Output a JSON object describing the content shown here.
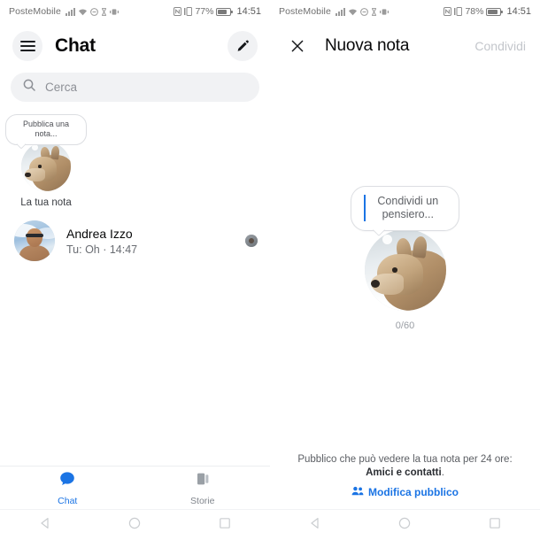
{
  "left": {
    "statusbar": {
      "carrier": "PosteMobile",
      "battery_pct": "77%",
      "clock": "14:51",
      "icons": [
        "signal-bars-icon",
        "wifi-icon",
        "dnd-icon",
        "hourglass-icon",
        "alarm-icon",
        "nfc-icon",
        "vibrate-icon",
        "battery-icon"
      ]
    },
    "appbar": {
      "menu_icon": "hamburger-menu-icon",
      "title": "Chat",
      "compose_icon": "pencil-edit-icon"
    },
    "search": {
      "icon": "search-icon",
      "placeholder": "Cerca"
    },
    "notes": {
      "bubble_text": "Pubblica una nota...",
      "label": "La tua nota",
      "avatar": "dog-avatar"
    },
    "chats": [
      {
        "name": "Andrea Izzo",
        "snippet": "Tu: Oh · 14:47",
        "avatar": "man-avatar",
        "receipt": "read-receipt-avatar"
      }
    ],
    "bottomnav": [
      {
        "label": "Chat",
        "icon": "chat-bubble-icon",
        "active": true
      },
      {
        "label": "Storie",
        "icon": "stories-icon",
        "active": false
      }
    ]
  },
  "right": {
    "statusbar": {
      "carrier": "PosteMobile",
      "battery_pct": "78%",
      "clock": "14:51"
    },
    "appbar": {
      "close_icon": "close-x-icon",
      "title": "Nuova nota",
      "action_label": "Condividi"
    },
    "composer": {
      "placeholder": "Condividi un pensiero...",
      "avatar": "dog-avatar",
      "counter": "0/60"
    },
    "audience": {
      "prefix": "Pubblico che può vedere la tua nota per 24 ore: ",
      "value": "Amici e contatti",
      "suffix": ".",
      "edit_icon": "people-icon",
      "edit_label": "Modifica pubblico"
    }
  },
  "androidnav": {
    "back": "back-triangle-icon",
    "home": "home-circle-icon",
    "recents": "recents-square-icon"
  },
  "colors": {
    "accent": "#1b74e4",
    "text_primary": "#080809",
    "text_secondary": "#6a6d73",
    "chip_bg": "#f1f2f4",
    "disabled": "#c3c6cb"
  }
}
